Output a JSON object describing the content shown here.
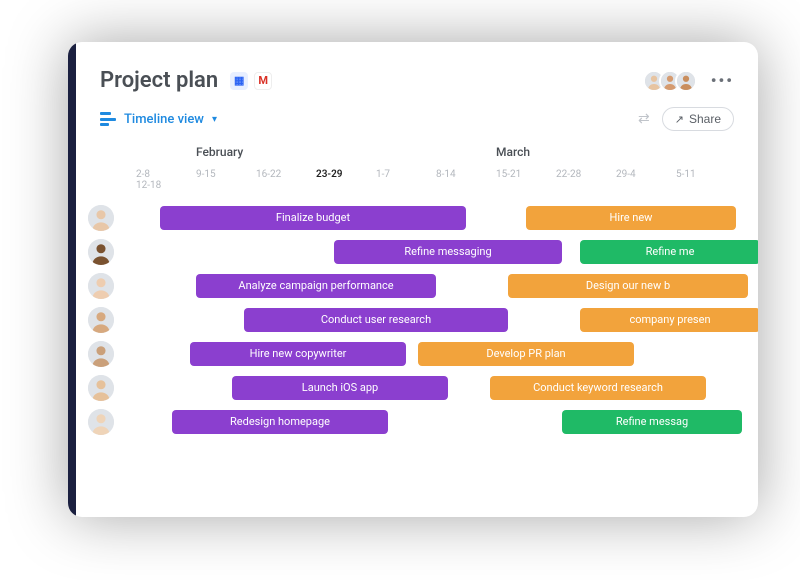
{
  "header": {
    "title": "Project plan",
    "more_label": "•••"
  },
  "toolbar": {
    "view_label": "Timeline view",
    "share_label": "Share"
  },
  "months": [
    "February",
    "March"
  ],
  "month_start_cols": [
    1,
    6
  ],
  "weeks": [
    "2-8",
    "9-15",
    "16-22",
    "23-29",
    "1-7",
    "8-14",
    "15-21",
    "22-28",
    "29-4",
    "5-11",
    "12-18"
  ],
  "current_week_index": 3,
  "colors": {
    "purple": "#8b3fcf",
    "orange": "#f2a33c",
    "green": "#1fba66"
  },
  "tasks": [
    {
      "row": 0,
      "label": "Finalize budget",
      "color": "purple",
      "start": 0.4,
      "span": 5.1
    },
    {
      "row": 0,
      "label": "Hire new",
      "color": "orange",
      "start": 6.5,
      "span": 3.5
    },
    {
      "row": 1,
      "label": "Refine messaging",
      "color": "purple",
      "start": 3.3,
      "span": 3.8
    },
    {
      "row": 1,
      "label": "Refine me",
      "color": "green",
      "start": 7.4,
      "span": 3.0
    },
    {
      "row": 2,
      "label": "Analyze campaign performance",
      "color": "purple",
      "start": 1.0,
      "span": 4.0
    },
    {
      "row": 2,
      "label": "Design our new b",
      "color": "orange",
      "start": 6.2,
      "span": 4.0
    },
    {
      "row": 3,
      "label": "Conduct user research",
      "color": "purple",
      "start": 1.8,
      "span": 4.4
    },
    {
      "row": 3,
      "label": "company presen",
      "color": "orange",
      "start": 7.4,
      "span": 3.0
    },
    {
      "row": 4,
      "label": "Hire new copywriter",
      "color": "purple",
      "start": 0.9,
      "span": 3.6
    },
    {
      "row": 4,
      "label": "Develop PR plan",
      "color": "orange",
      "start": 4.7,
      "span": 3.6
    },
    {
      "row": 5,
      "label": "Launch iOS app",
      "color": "purple",
      "start": 1.6,
      "span": 3.6
    },
    {
      "row": 5,
      "label": "Conduct keyword research",
      "color": "orange",
      "start": 5.9,
      "span": 3.6
    },
    {
      "row": 6,
      "label": "Redesign homepage",
      "color": "purple",
      "start": 0.6,
      "span": 3.6
    },
    {
      "row": 6,
      "label": "Refine messag",
      "color": "green",
      "start": 7.1,
      "span": 3.0
    }
  ],
  "avatars_skin": [
    "#e8c7a8",
    "#7a5230",
    "#eecdb0",
    "#d7a97f",
    "#caa07a",
    "#e6c19a",
    "#efd4b8"
  ],
  "header_avatars_skin": [
    "#e7c4a1",
    "#d59b70",
    "#c98e5e"
  ]
}
